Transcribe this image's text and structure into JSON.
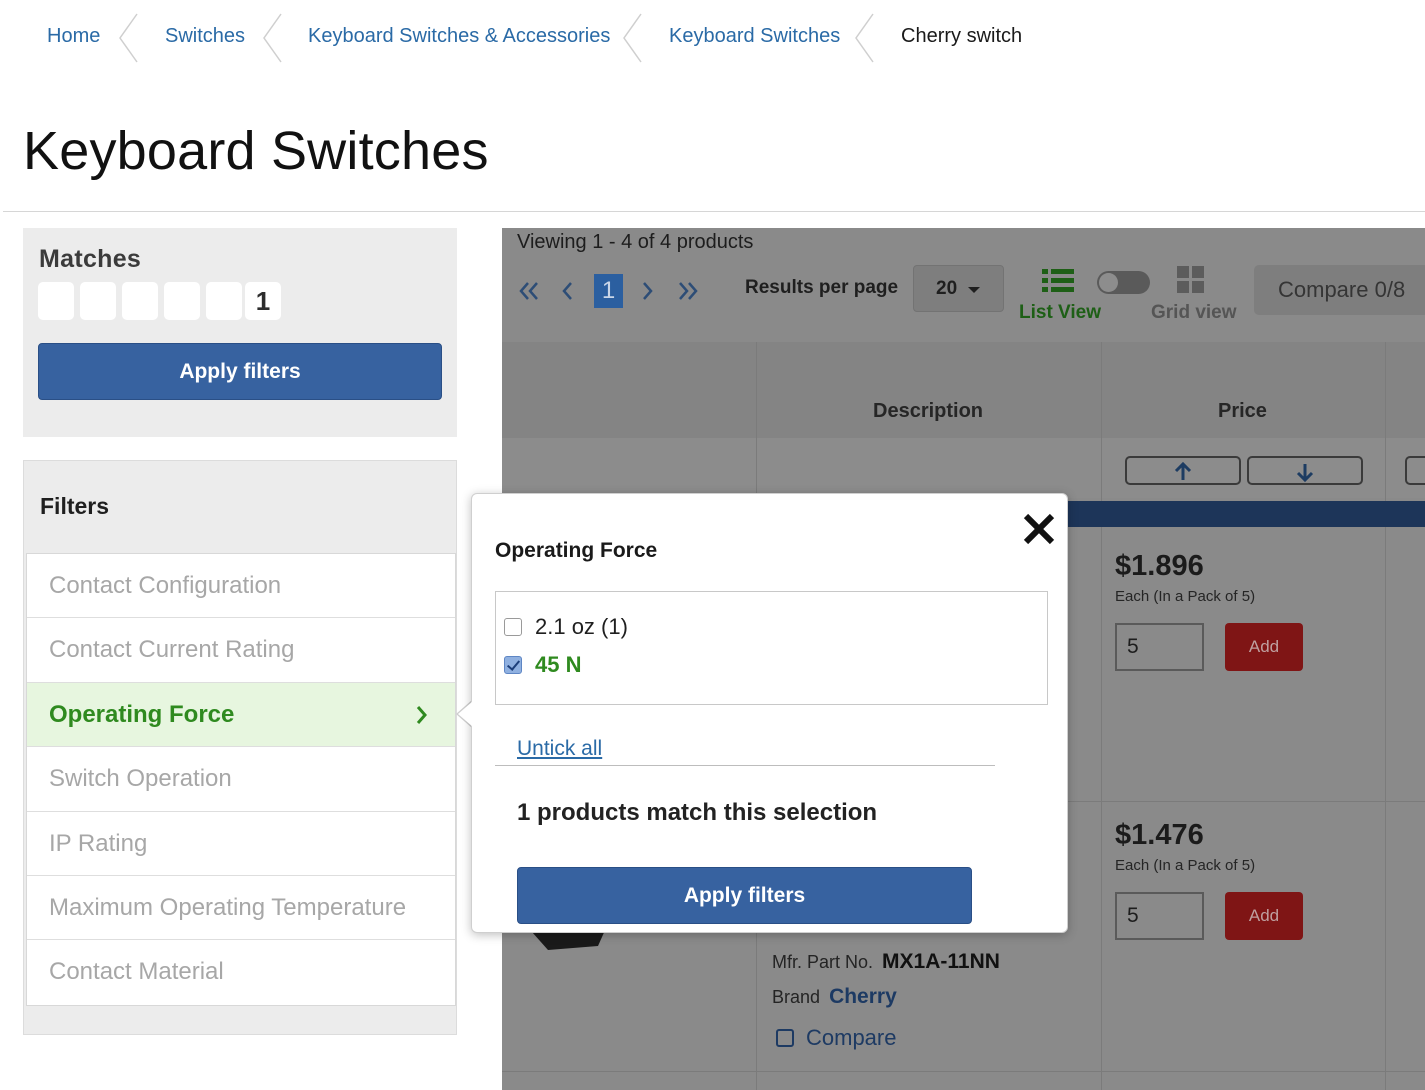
{
  "breadcrumb": {
    "items": [
      {
        "label": "Home"
      },
      {
        "label": "Switches"
      },
      {
        "label": "Keyboard Switches & Accessories"
      },
      {
        "label": "Keyboard Switches"
      }
    ],
    "current": "Cherry switch"
  },
  "page": {
    "title": "Keyboard Switches"
  },
  "matches": {
    "label": "Matches",
    "digits": [
      "",
      "",
      "",
      "",
      "",
      "1"
    ],
    "apply_label": "Apply filters"
  },
  "filters": {
    "heading": "Filters",
    "items": [
      {
        "label": "Contact Configuration"
      },
      {
        "label": "Contact Current Rating"
      },
      {
        "label": "Operating Force",
        "active": true
      },
      {
        "label": "Switch Operation"
      },
      {
        "label": "IP Rating"
      },
      {
        "label": "Maximum Operating Temperature"
      },
      {
        "label": "Contact Material"
      }
    ]
  },
  "results": {
    "viewing": "Viewing 1 - 4 of 4 products",
    "current_page": "1",
    "per_page_label": "Results per page",
    "per_page_value": "20",
    "list_view_label": "List View",
    "grid_view_label": "Grid view",
    "compare_label": "Compare 0/8",
    "columns": {
      "description": "Description",
      "price": "Price"
    },
    "products": [
      {
        "price": "$1.896",
        "each": "Each (In a Pack of 5)",
        "qty": "5",
        "add_label": "Add"
      },
      {
        "price": "$1.476",
        "each": "Each (In a Pack of 5)",
        "qty": "5",
        "add_label": "Add",
        "mfr_label": "Mfr. Part No.",
        "mfr_value": "MX1A-11NN",
        "brand_label": "Brand",
        "brand_value": "Cherry",
        "compare_label": "Compare"
      }
    ]
  },
  "popup": {
    "title": "Operating Force",
    "options": [
      {
        "label": "2.1 oz (1)",
        "checked": false
      },
      {
        "label": "45 N",
        "checked": true
      }
    ],
    "untick_label": "Untick all",
    "match_text": "1 products match this selection",
    "apply_label": "Apply filters"
  },
  "colors": {
    "link": "#2a6aa6",
    "primary_button": "#3762a0",
    "active_filter_text": "#2f8a1f",
    "active_filter_bg": "#e7f6df",
    "add_button": "#c62828"
  },
  "icons": [
    "chevron-separator-icon",
    "first-page-icon",
    "prev-page-icon",
    "next-page-icon",
    "last-page-icon",
    "list-view-icon",
    "grid-view-icon",
    "sort-asc-icon",
    "sort-desc-icon",
    "close-icon",
    "chevron-right-icon",
    "dropdown-caret-icon"
  ]
}
